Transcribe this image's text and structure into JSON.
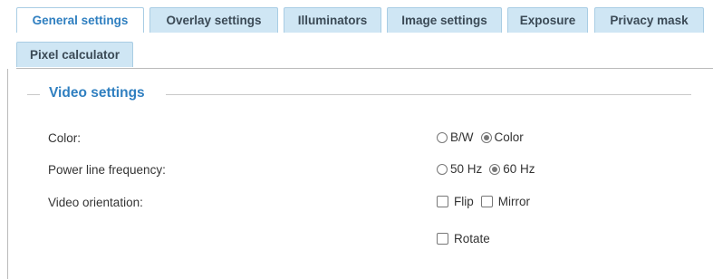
{
  "tabs": [
    {
      "label": "General settings",
      "active": true
    },
    {
      "label": "Overlay settings",
      "active": false
    },
    {
      "label": "Illuminators",
      "active": false
    },
    {
      "label": "Image settings",
      "active": false
    },
    {
      "label": "Exposure",
      "active": false
    },
    {
      "label": "Privacy mask",
      "active": false
    },
    {
      "label": "Pixel calculator",
      "active": false
    }
  ],
  "section": {
    "title": "Video settings"
  },
  "settings": {
    "color": {
      "label": "Color:",
      "options": [
        {
          "label": "B/W",
          "checked": false
        },
        {
          "label": "Color",
          "checked": true
        }
      ]
    },
    "power_line": {
      "label": "Power line frequency:",
      "options": [
        {
          "label": "50 Hz",
          "checked": false
        },
        {
          "label": "60 Hz",
          "checked": true
        }
      ]
    },
    "orientation": {
      "label": "Video orientation:",
      "options": [
        {
          "label": "Flip",
          "checked": false
        },
        {
          "label": "Mirror",
          "checked": false
        },
        {
          "label": "Rotate",
          "checked": false
        }
      ]
    }
  },
  "colors": {
    "accent": "#2f7fc0",
    "tab_bg": "#cfe6f4",
    "tab_border": "#a9cde4"
  }
}
